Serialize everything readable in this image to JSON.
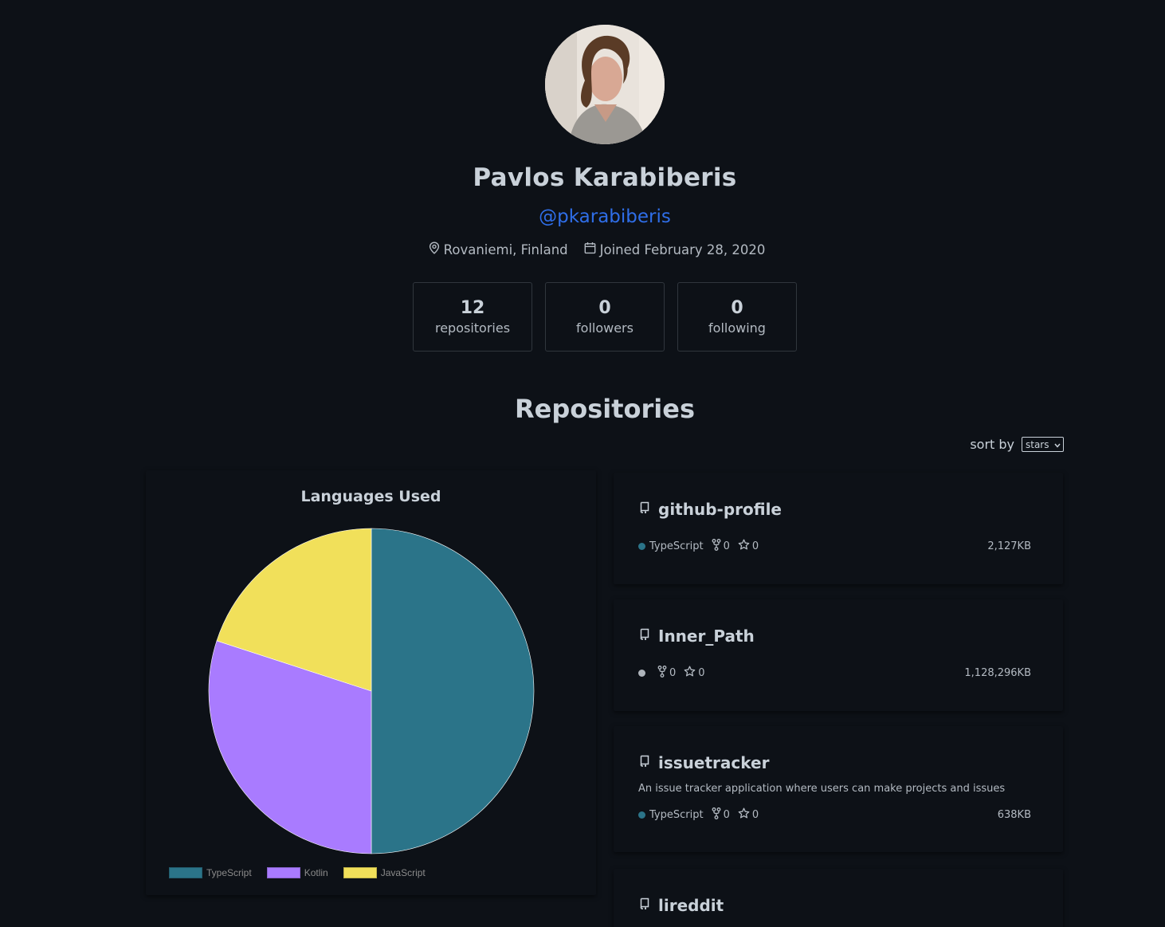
{
  "profile": {
    "name": "Pavlos Karabiberis",
    "login": "@pkarabiberis",
    "location": "Rovaniemi, Finland",
    "joined": "Joined February 28, 2020"
  },
  "stats": [
    {
      "value": "12",
      "label": "repositories"
    },
    {
      "value": "0",
      "label": "followers"
    },
    {
      "value": "0",
      "label": "following"
    }
  ],
  "repositories_section": {
    "title": "Repositories",
    "sort_label": "sort by",
    "sort_value": "stars"
  },
  "chart_data": {
    "type": "pie",
    "title": "Languages Used",
    "categories": [
      "TypeScript",
      "Kotlin",
      "JavaScript"
    ],
    "values": [
      5,
      3,
      2
    ],
    "colors": [
      "#2b7489",
      "#A97BFF",
      "#f1e05a"
    ],
    "legend": "bottom-left"
  },
  "repos": [
    {
      "name": "github-profile",
      "description": "",
      "language": "TypeScript",
      "language_color": "#2b7489",
      "forks": "0",
      "stars": "0",
      "size": "2,127KB"
    },
    {
      "name": "Inner_Path",
      "description": "",
      "language": "",
      "language_color": "#aeb4bb",
      "forks": "0",
      "stars": "0",
      "size": "1,128,296KB"
    },
    {
      "name": "issuetracker",
      "description": "An issue tracker application where users can make projects and issues",
      "language": "TypeScript",
      "language_color": "#2b7489",
      "forks": "0",
      "stars": "0",
      "size": "638KB"
    },
    {
      "name": "lireddit",
      "description": "",
      "language": "",
      "language_color": "",
      "forks": "",
      "stars": "",
      "size": ""
    }
  ],
  "icons": {
    "location": "location-pin-icon",
    "calendar": "calendar-icon",
    "repo": "repo-book-icon",
    "fork": "fork-icon",
    "star": "star-icon",
    "dropdown": "chevron-down-icon"
  }
}
